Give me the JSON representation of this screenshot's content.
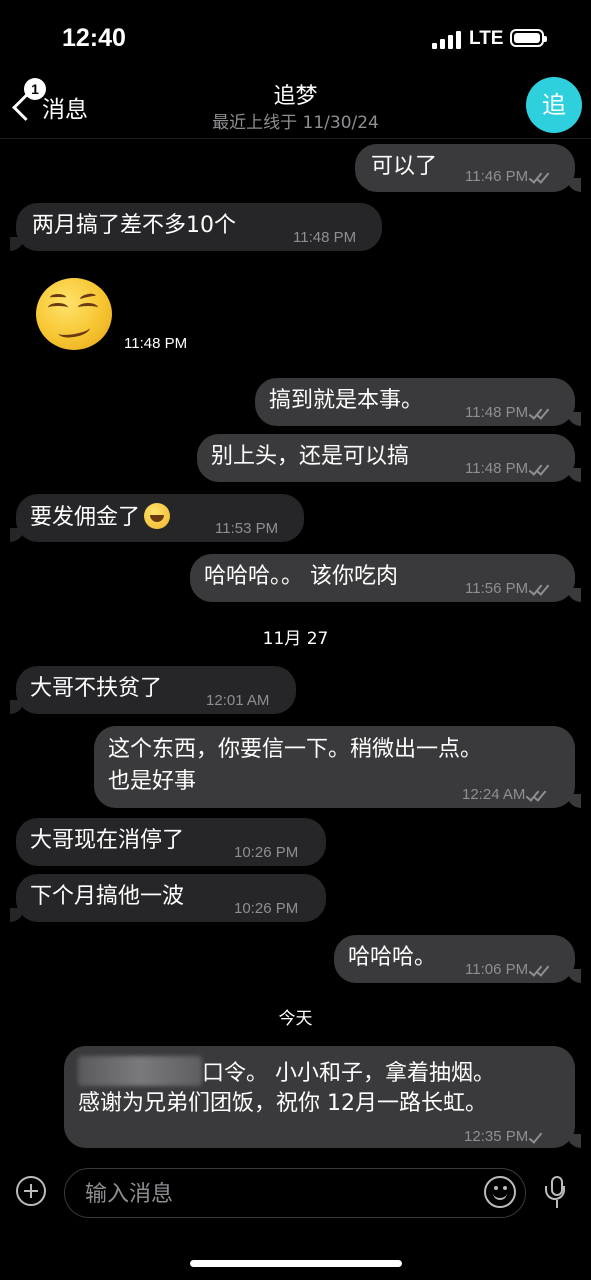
{
  "status_bar": {
    "time": "12:40",
    "network": "LTE"
  },
  "header": {
    "back_badge": "1",
    "back_label": "消息",
    "title": "追梦",
    "subtitle": "最近上线于 11/30/24",
    "avatar_letter": "追",
    "avatar_color": "#2fd0dd"
  },
  "messages": [
    {
      "dir": "out",
      "text": "可以了",
      "time": "11:46 PM",
      "read": true
    },
    {
      "dir": "in",
      "text": "两月搞了差不多10个",
      "time": "11:48 PM"
    },
    {
      "dir": "in",
      "type": "sticker",
      "sticker": "smirking-face",
      "time": "11:48 PM"
    },
    {
      "dir": "out",
      "text": "搞到就是本事。",
      "time": "11:48 PM",
      "read": true
    },
    {
      "dir": "out",
      "text": "别上头，还是可以搞",
      "time": "11:48 PM",
      "read": true
    },
    {
      "dir": "in",
      "text": "要发佣金了",
      "emoji": "laughing-tears",
      "time": "11:53 PM"
    },
    {
      "dir": "out",
      "text": "哈哈哈。。 该你吃肉",
      "time": "11:56 PM",
      "read": true
    },
    {
      "type": "date",
      "text": "11月 27"
    },
    {
      "dir": "in",
      "text": "大哥不扶贫了",
      "time": "12:01 AM"
    },
    {
      "dir": "out",
      "lines": [
        "这个东西，你要信一下。稍微出一点。",
        "也是好事"
      ],
      "time": "12:24 AM",
      "read": true
    },
    {
      "dir": "in",
      "text": "大哥现在消停了",
      "time": "10:26 PM"
    },
    {
      "dir": "in",
      "text": "下个月搞他一波",
      "time": "10:26 PM"
    },
    {
      "dir": "out",
      "text": "哈哈哈。",
      "time": "11:06 PM",
      "read": true
    },
    {
      "type": "date",
      "text": "今天"
    },
    {
      "dir": "out",
      "lines": [
        "口令。 小小和子，拿着抽烟。",
        "感谢为兄弟们团饭，祝你 12月一路长虹。"
      ],
      "redacted_prefix": true,
      "time": "12:35 PM",
      "read": false
    }
  ],
  "input": {
    "placeholder": "输入消息"
  },
  "icons": [
    "back-chevron-icon",
    "attach-plus-icon",
    "emoji-icon",
    "microphone-icon",
    "double-check-icon",
    "single-check-icon"
  ]
}
